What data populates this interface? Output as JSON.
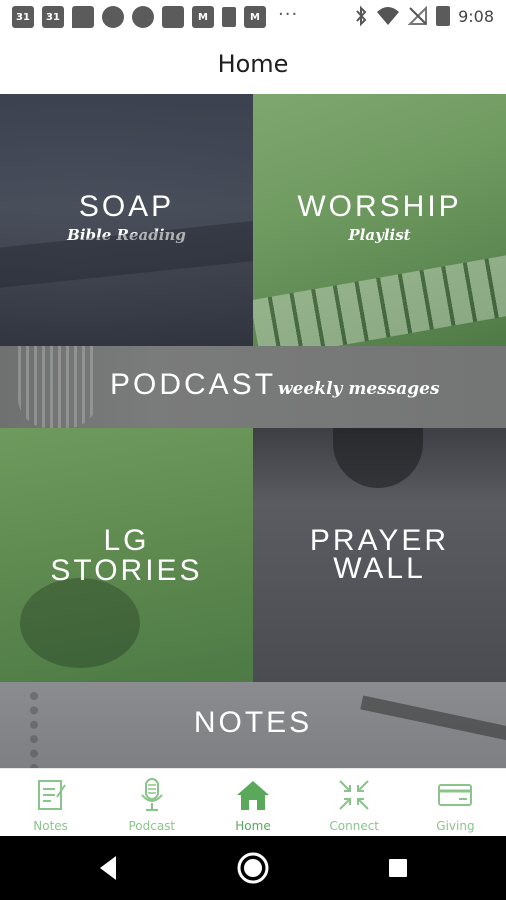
{
  "status_bar": {
    "time": "9:08",
    "calendar_day_1": "31",
    "calendar_day_2": "31",
    "icons_left": [
      "calendar-icon",
      "calendar-icon",
      "message-icon",
      "slack-icon",
      "circle-icon",
      "square-icon",
      "gmail-icon",
      "phone-upload-icon",
      "gmail-icon"
    ],
    "icons_right": [
      "bluetooth-icon",
      "wifi-icon",
      "no-signal-icon",
      "battery-icon"
    ],
    "overflow": "···"
  },
  "header": {
    "title": "Home"
  },
  "tiles": {
    "soap": {
      "title": "SOAP",
      "subtitle": "Bible Reading"
    },
    "worship": {
      "title": "WORSHIP",
      "subtitle": "Playlist"
    },
    "podcast": {
      "title": "PODCAST",
      "subtitle": "weekly messages"
    },
    "lg_stories": {
      "line1": "LG",
      "line2": "STORIES"
    },
    "prayer_wall": {
      "line1": "PRAYER",
      "line2": "WALL"
    },
    "notes": {
      "title": "NOTES"
    }
  },
  "tab_bar": {
    "tabs": [
      {
        "label": "Notes",
        "icon": "notes-icon"
      },
      {
        "label": "Podcast",
        "icon": "microphone-icon"
      },
      {
        "label": "Home",
        "icon": "home-icon",
        "active": true
      },
      {
        "label": "Connect",
        "icon": "connect-arrows-icon"
      },
      {
        "label": "Giving",
        "icon": "credit-card-icon"
      }
    ]
  },
  "colors": {
    "tab_inactive": "#8bc48b",
    "tab_active": "#5aa85a",
    "green_tile": "#6f9a60",
    "gray_tile": "#4a4c52"
  }
}
